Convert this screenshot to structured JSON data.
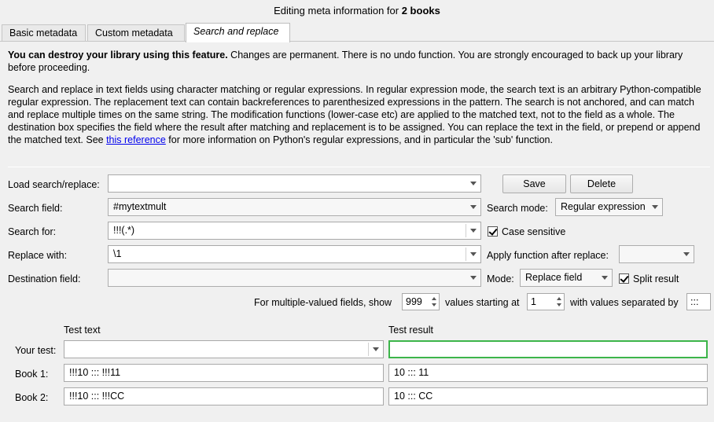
{
  "window": {
    "title_prefix": "Editing meta information for ",
    "title_bold": "2 books"
  },
  "tabs": [
    {
      "label": "Basic metadata"
    },
    {
      "label": "Custom metadata"
    },
    {
      "label": "Search and replace"
    }
  ],
  "warning": {
    "bold": "You can destroy your library using this feature.",
    "rest": " Changes are permanent. There is no undo function. You are strongly encouraged to back up your library before proceeding."
  },
  "description": {
    "text": "Search and replace in text fields using character matching or regular expressions. In regular expression mode, the search text is an arbitrary Python-compatible regular expression. The replacement text can contain backreferences to parenthesized expressions in the pattern. The search is not anchored, and can match and replace multiple times on the same string. The modification functions (lower-case etc) are applied to the matched text, not to the field as a whole. The destination box specifies the field where the result after matching and replacement is to be assigned. You can replace the text in the field, or prepend or append the matched text. See ",
    "link": "this reference",
    "after": " for more information on Python's regular expressions, and in particular the 'sub' function."
  },
  "form": {
    "load_label": "Load search/replace:",
    "load_value": "",
    "save_button": "Save",
    "delete_button": "Delete",
    "search_field_label": "Search field:",
    "search_field_value": "#mytextmult",
    "search_mode_label": "Search mode:",
    "search_mode_value": "Regular expression",
    "search_for_label": "Search for:",
    "search_for_value": "!!!(.*)",
    "case_sensitive_label": "Case sensitive",
    "case_sensitive_checked": true,
    "replace_with_label": "Replace with:",
    "replace_with_value": "\\1",
    "apply_function_label": "Apply function after replace:",
    "apply_function_value": "",
    "destination_label": "Destination field:",
    "destination_value": "",
    "mode_label": "Mode:",
    "mode_value": "Replace field",
    "split_result_label": "Split result",
    "split_result_checked": true,
    "multi_prefix": "For multiple-valued fields, show",
    "multi_show_value": "999",
    "multi_middle": "values starting at",
    "multi_start_value": "1",
    "multi_suffix": "with values separated by",
    "multi_separator_value": ":::"
  },
  "test": {
    "test_text_header": "Test text",
    "test_result_header": "Test result",
    "your_test_label": "Your test:",
    "your_test_value": "",
    "your_test_result": "",
    "rows": [
      {
        "label": "Book 1:",
        "text": "!!!10 ::: !!!11",
        "result": "10 ::: 11"
      },
      {
        "label": "Book 2:",
        "text": "!!!10 ::: !!!CC",
        "result": "10 ::: CC"
      }
    ]
  }
}
